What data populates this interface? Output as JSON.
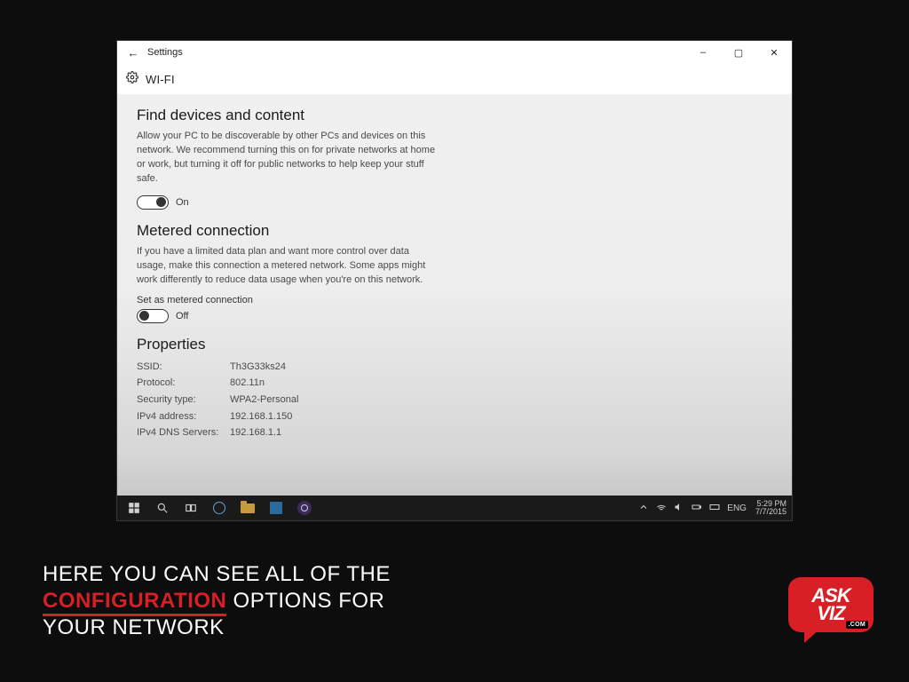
{
  "window": {
    "title": "Settings",
    "page": "WI-FI",
    "controls": {
      "minimize": "–",
      "maximize": "▢",
      "close": "✕"
    }
  },
  "find_devices": {
    "heading": "Find devices and content",
    "body": "Allow your PC to be discoverable by other PCs and devices on this network. We recommend turning this on for private networks at home or work, but turning it off for public networks to help keep your stuff safe.",
    "toggle_state": "On"
  },
  "metered": {
    "heading": "Metered connection",
    "body": "If you have a limited data plan and want more control over data usage, make this connection a metered network. Some apps might work differently to reduce data usage when you're on this network.",
    "field_label": "Set as metered connection",
    "toggle_state": "Off"
  },
  "properties": {
    "heading": "Properties",
    "rows": [
      {
        "k": "SSID:",
        "v": "Th3G33ks24"
      },
      {
        "k": "Protocol:",
        "v": "802.11n"
      },
      {
        "k": "Security type:",
        "v": "WPA2-Personal"
      },
      {
        "k": "IPv4 address:",
        "v": "192.168.1.150"
      },
      {
        "k": "IPv4 DNS Servers:",
        "v": "192.168.1.1"
      }
    ]
  },
  "taskbar": {
    "lang": "ENG",
    "time": "5:29 PM",
    "date": "7/7/2015"
  },
  "caption": {
    "line1_pre": "Here you can see all of the",
    "highlight": "configuration",
    "line2_post": "options for",
    "line3": "your network"
  },
  "brand": {
    "top": "ASK",
    "bottom": "VIZ",
    "domain": ".COM"
  }
}
